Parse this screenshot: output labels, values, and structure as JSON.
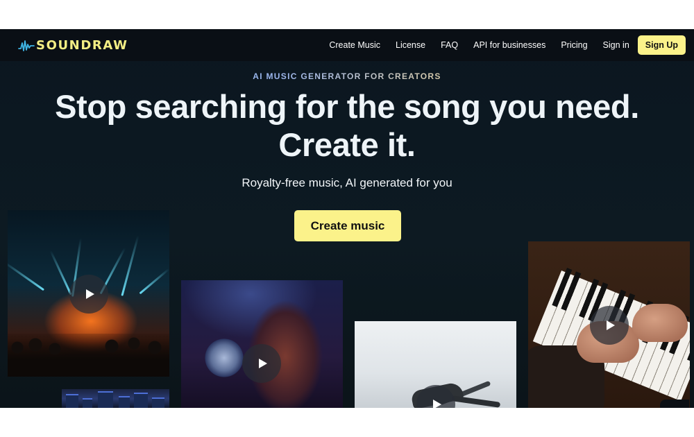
{
  "header": {
    "logo_text": "SOUNDRAW",
    "nav": [
      "Create Music",
      "License",
      "FAQ",
      "API for businesses",
      "Pricing",
      "Sign in"
    ],
    "signup_label": "Sign Up"
  },
  "hero": {
    "eyebrow": "AI MUSIC GENERATOR FOR CREATORS",
    "headline_line1": "Stop searching for the song you need.",
    "headline_line2": "Create it.",
    "subhead": "Royalty-free music, AI generated for you",
    "cta_label": "Create music"
  },
  "media_tiles": [
    {
      "name": "concert",
      "icon": "play-icon"
    },
    {
      "name": "disco-ball",
      "icon": "play-icon"
    },
    {
      "name": "dancer",
      "icon": "play-icon"
    },
    {
      "name": "piano",
      "icon": "play-icon"
    },
    {
      "name": "city-night",
      "icon": "none"
    }
  ],
  "chat_widget": {
    "icon": "chat-icon"
  },
  "colors": {
    "accent_yellow": "#fbf28a",
    "logo_yellow": "#f3ee84",
    "background": "#0b1620",
    "header_bg": "#0a0f15"
  }
}
